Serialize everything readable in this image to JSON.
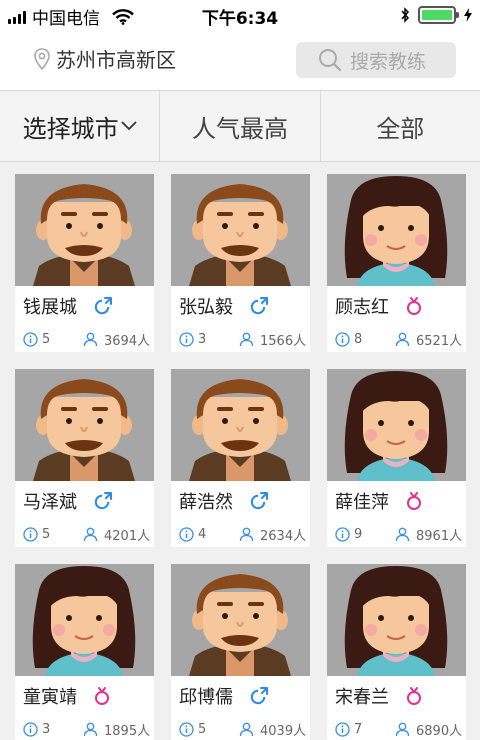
{
  "status_bar": {
    "carrier": "中国电信",
    "time": "下午6:34"
  },
  "header": {
    "location": "苏州市高新区",
    "search_placeholder": "搜索教练"
  },
  "tabs": [
    {
      "label": "选择城市"
    },
    {
      "label": "人气最高"
    },
    {
      "label": "全部"
    }
  ],
  "coaches": [
    {
      "name": "钱展城",
      "gender": "male",
      "rating": "5",
      "students": "3694人"
    },
    {
      "name": "张弘毅",
      "gender": "male",
      "rating": "3",
      "students": "1566人"
    },
    {
      "name": "顾志红",
      "gender": "female",
      "rating": "8",
      "students": "6521人"
    },
    {
      "name": "马泽斌",
      "gender": "male",
      "rating": "5",
      "students": "4201人"
    },
    {
      "name": "薛浩然",
      "gender": "male",
      "rating": "4",
      "students": "2634人"
    },
    {
      "name": "薛佳萍",
      "gender": "female",
      "rating": "9",
      "students": "8961人"
    },
    {
      "name": "童寅靖",
      "gender": "female",
      "rating": "3",
      "students": "1895人"
    },
    {
      "name": "邱博儒",
      "gender": "male",
      "rating": "5",
      "students": "4039人"
    },
    {
      "name": "宋春兰",
      "gender": "female",
      "rating": "7",
      "students": "6890人"
    }
  ],
  "colors": {
    "male_icon": "#2b8be8",
    "female_icon": "#e0338f",
    "stat_icon": "#3a8fe0",
    "battery": "#4cd964"
  },
  "icons": {
    "location": "map-pin-icon",
    "search": "search-icon",
    "dropdown": "chevron-down-icon",
    "info": "info-icon",
    "students": "user-icon"
  }
}
